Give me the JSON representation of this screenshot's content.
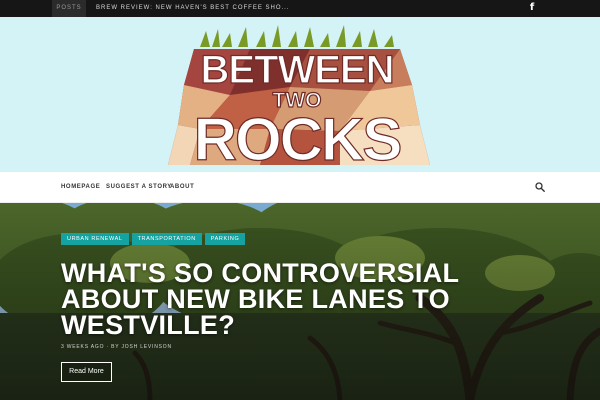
{
  "topbar": {
    "posts_label": "POSTS",
    "ticker_text": "BREW REVIEW: NEW HAVEN'S BEST COFFEE SHO...",
    "social_icon": "facebook-icon",
    "social_glyph": "f"
  },
  "logo": {
    "line1": "BETWEEN",
    "line2": "TWO",
    "line3": "ROCKS"
  },
  "nav": {
    "items": [
      {
        "label": "HOMEPAGE"
      },
      {
        "label": "SUGGEST A STORY"
      },
      {
        "label": "ABOUT"
      }
    ],
    "search_icon": "search-icon"
  },
  "hero": {
    "tags": [
      {
        "label": "URBAN RENEWAL"
      },
      {
        "label": "TRANSPORTATION"
      },
      {
        "label": "PARKING"
      }
    ],
    "headline": "WHAT'S SO CONTROVERSIAL ABOUT NEW BIKE LANES TO WESTVILLE?",
    "meta": "3 WEEKS AGO · BY JOSH LEVINSON",
    "read_more": "Read More"
  },
  "colors": {
    "topbar": "#161616",
    "masthead": "#d4f3f6",
    "tag": "#14a3a0",
    "logo_accent": "#b0473a"
  }
}
